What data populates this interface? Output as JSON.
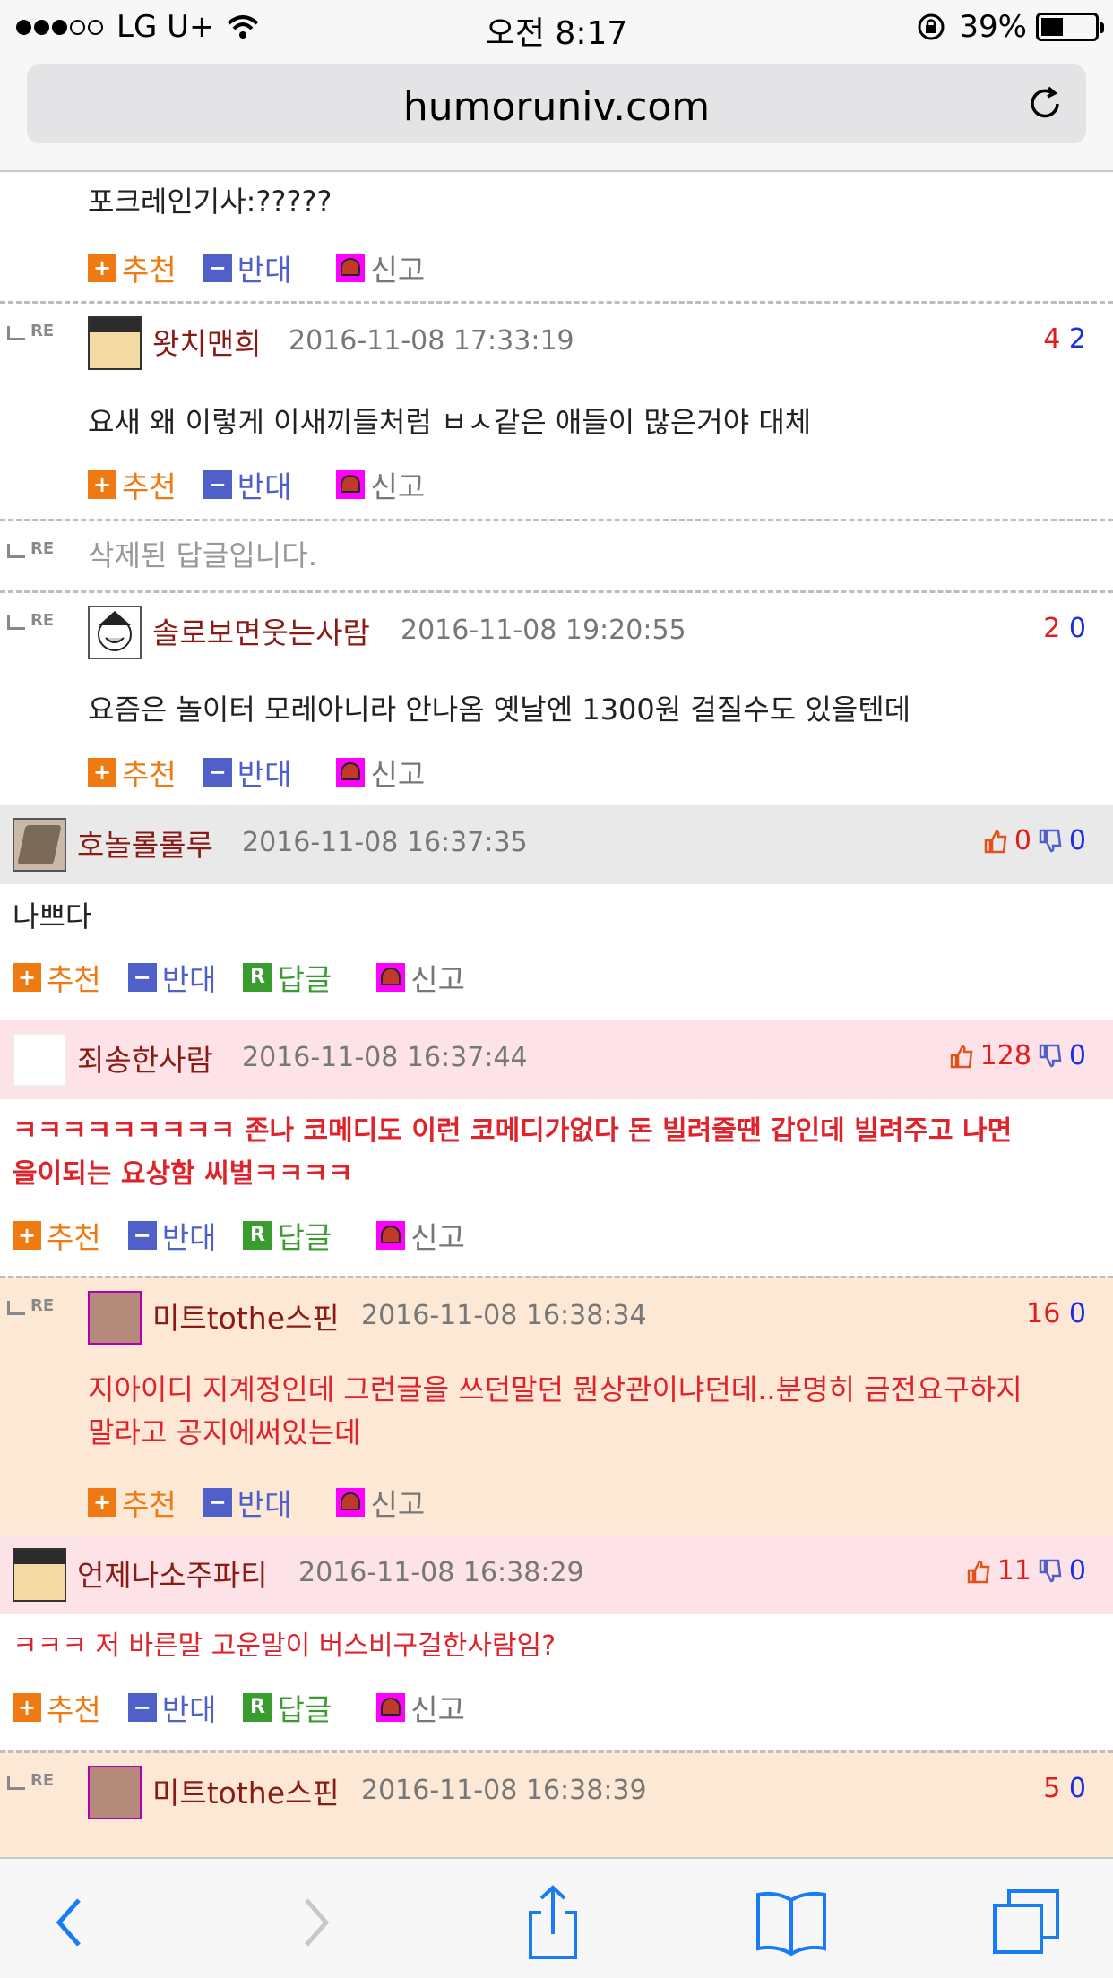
{
  "status": {
    "carrier": "LG U+",
    "time": "오전 8:17",
    "battery": "39%",
    "battery_level": 0.39
  },
  "browser": {
    "url": "humoruniv.com"
  },
  "colors": {
    "author": "#8a1b14",
    "up": "#e41b1b",
    "down": "#1b2ee4",
    "plus": "#f07a12",
    "minus": "#4f61c9",
    "reply": "#3a9c2f",
    "report": "#ff00ff",
    "pink_row": "#fde3e7",
    "peach_row": "#fde8d6",
    "gray_row": "#e9e9e9"
  },
  "labels": {
    "recommend": "추천",
    "oppose": "반대",
    "reply": "답글",
    "report": "신고",
    "re": "RE"
  },
  "comments": [
    {
      "body": "포크레인기사:?????"
    },
    {
      "author": "왓치맨희",
      "date": "2016-11-08 17:33:19",
      "up": "4",
      "down": "2",
      "body": "요새 왜 이렇게 이새끼들처럼 ㅂㅅ같은 애들이 많은거야 대체"
    },
    {
      "deleted": "삭제된 답글입니다."
    },
    {
      "author": "솔로보면웃는사람",
      "date": "2016-11-08 19:20:55",
      "up": "2",
      "down": "0",
      "body": "요즘은 놀이터 모레아니라 안나옴 옛날엔 1300원 걸질수도 있을텐데"
    },
    {
      "author": "호놀롤롤루",
      "date": "2016-11-08 16:37:35",
      "up": "0",
      "down": "0",
      "body": "나쁘다"
    },
    {
      "author": "죄송한사람",
      "date": "2016-11-08 16:37:44",
      "up": "128",
      "down": "0",
      "body_line1": "ㅋㅋㅋㅋㅋㅋㅋㅋㅋ 존나 코메디도 이런 코메디가없다 돈 빌려줄땐 갑인데 빌려주고 나면",
      "body_line2": "을이되는 요상함 씨벌ㅋㅋㅋㅋ"
    },
    {
      "author": "미트tothe스핀",
      "date": "2016-11-08 16:38:34",
      "up": "16",
      "down": "0",
      "body_line1": "지아이디 지계정인데 그런글을 쓰던말던 뭔상관이냐던데..분명히 금전요구하지",
      "body_line2": "말라고 공지에써있는데"
    },
    {
      "author": "언제나소주파티",
      "date": "2016-11-08 16:38:29",
      "up": "11",
      "down": "0",
      "body": "ㅋㅋㅋ 저 바른말 고운말이 버스비구걸한사람임?"
    },
    {
      "author": "미트tothe스핀",
      "date": "2016-11-08 16:38:39",
      "up": "5",
      "down": "0"
    }
  ],
  "toolbar": {
    "back": "back-icon",
    "forward": "forward-icon",
    "share": "share-icon",
    "bookmarks": "book-icon",
    "tabs": "tabs-icon"
  }
}
